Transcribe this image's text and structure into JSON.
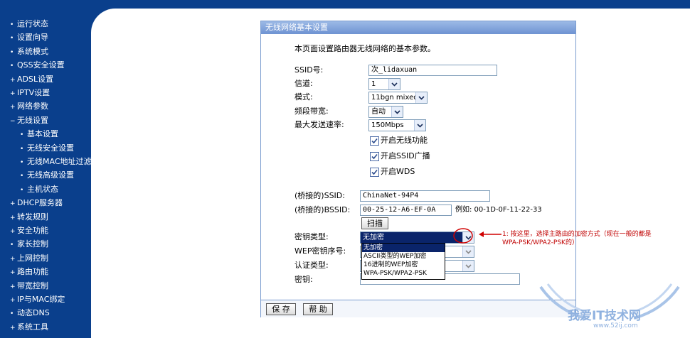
{
  "sidebar": {
    "items": [
      {
        "marker": "•",
        "label": "运行状态"
      },
      {
        "marker": "•",
        "label": "设置向导"
      },
      {
        "marker": "•",
        "label": "系统模式"
      },
      {
        "marker": "•",
        "label": "QSS安全设置"
      },
      {
        "marker": "+",
        "label": "ADSL设置"
      },
      {
        "marker": "+",
        "label": "IPTV设置"
      },
      {
        "marker": "+",
        "label": "网络参数"
      },
      {
        "marker": "−",
        "label": "无线设置"
      },
      {
        "marker": "•",
        "label": "基本设置"
      },
      {
        "marker": "•",
        "label": "无线安全设置"
      },
      {
        "marker": "•",
        "label": "无线MAC地址过滤"
      },
      {
        "marker": "•",
        "label": "无线高级设置"
      },
      {
        "marker": "•",
        "label": "主机状态"
      },
      {
        "marker": "+",
        "label": "DHCP服务器"
      },
      {
        "marker": "+",
        "label": "转发规则"
      },
      {
        "marker": "+",
        "label": "安全功能"
      },
      {
        "marker": "•",
        "label": "家长控制"
      },
      {
        "marker": "+",
        "label": "上网控制"
      },
      {
        "marker": "+",
        "label": "路由功能"
      },
      {
        "marker": "+",
        "label": "带宽控制"
      },
      {
        "marker": "+",
        "label": "IP与MAC绑定"
      },
      {
        "marker": "•",
        "label": "动态DNS"
      },
      {
        "marker": "+",
        "label": "系统工具"
      }
    ]
  },
  "panel": {
    "title": "无线网络基本设置",
    "description": "本页面设置路由器无线网络的基本参数。"
  },
  "form": {
    "ssid_label": "SSID号:",
    "ssid_value": "次_lidaxuan",
    "channel_label": "信道:",
    "channel_value": "1",
    "mode_label": "模式:",
    "mode_value": "11bgn mixed",
    "bandwidth_label": "频段带宽:",
    "bandwidth_value": "自动",
    "maxrate_label": "最大发送速率:",
    "maxrate_value": "150Mbps",
    "enable_wireless": "开启无线功能",
    "enable_ssid_broadcast": "开启SSID广播",
    "enable_wds": "开启WDS",
    "bridge_ssid_label": "(桥接的)SSID:",
    "bridge_ssid_value": "ChinaNet-94P4",
    "bridge_bssid_label": "(桥接的)BSSID:",
    "bridge_bssid_value": "00-25-12-A6-EF-0A",
    "bssid_example": "例如: 00-1D-0F-11-22-33",
    "scan_button": "扫描",
    "key_type_label": "密钥类型:",
    "key_type_value": "无加密",
    "wep_index_label": "WEP密钥序号:",
    "auth_type_label": "认证类型:",
    "key_label": "密钥:",
    "key_type_options": [
      "无加密",
      "ASCII类型的WEP加密",
      "16进制的WEP加密",
      "WPA-PSK/WPA2-PSK"
    ]
  },
  "footer": {
    "save_button": "保 存",
    "help_button": "帮 助"
  },
  "annotation": {
    "line1": "1: 按这里，选择主路由的加密方式（现在一般的都是",
    "line2": "WPA-PSK/WPA2-PSK的）"
  },
  "watermark": {
    "brand": "我爱IT技术网",
    "url": "www.52ij.com"
  },
  "colors": {
    "sidebar_bg": "#0a3f8c",
    "panel_header": "#7a9ccf",
    "highlight": "#0a246a",
    "annotation_red": "#c00000"
  }
}
